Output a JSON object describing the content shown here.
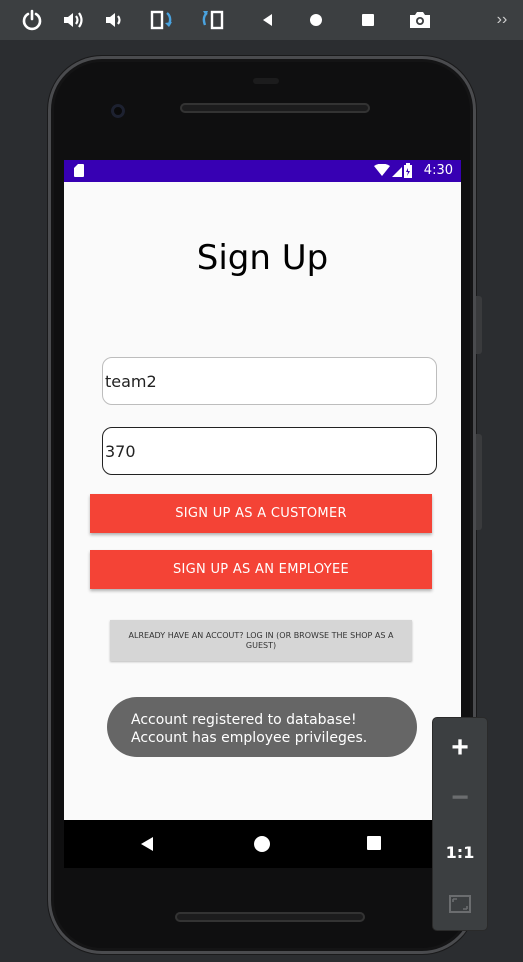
{
  "toolbar": {
    "icons": [
      "power-icon",
      "volume-up-icon",
      "volume-down-icon",
      "rotate-left-icon",
      "rotate-right-icon",
      "back-icon",
      "home-icon",
      "overview-icon",
      "screenshot-icon",
      "more-icon"
    ],
    "more_label": "››"
  },
  "status_bar": {
    "time": "4:30",
    "color": "#3700b3"
  },
  "screen": {
    "title": "Sign Up",
    "username_value": "team2",
    "password_value": "370",
    "customer_button": "SIGN UP AS A CUSTOMER",
    "employee_button": "SIGN UP AS AN EMPLOYEE",
    "login_button": "ALREADY HAVE AN ACCOUT? LOG IN (OR BROWSE THE SHOP AS A GUEST)",
    "toast": "Account registered to database! Account has employee privileges.",
    "accent_color": "#f44336"
  },
  "zoom_controls": {
    "zoom_in": "+",
    "zoom_out": "−",
    "actual_size": "1:1",
    "fit_screen": "fit-screen-icon"
  }
}
